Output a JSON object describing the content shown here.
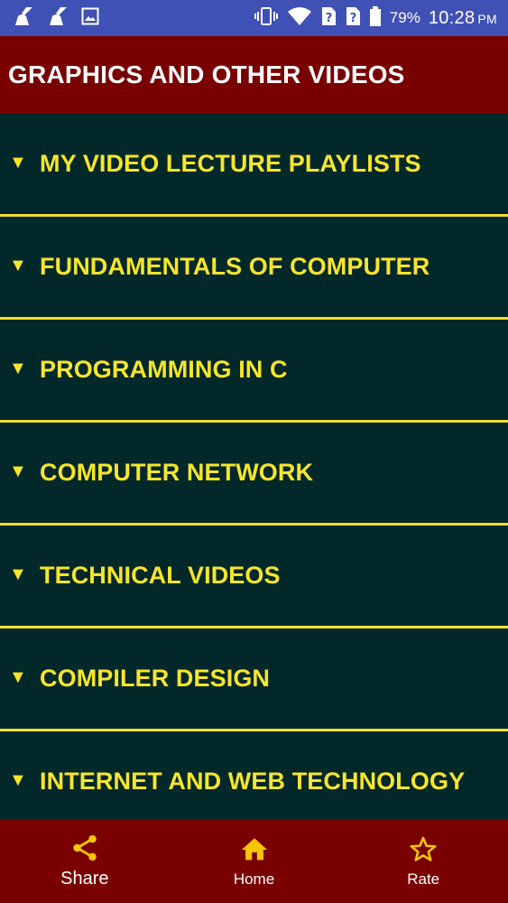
{
  "status_bar": {
    "battery_percent": "79%",
    "time": "10:28",
    "ampm": "PM",
    "icons": [
      "cleaner-icon",
      "cleaner-icon",
      "image-icon",
      "vibrate-icon",
      "wifi-icon",
      "sim-unknown-icon",
      "sim-unknown-icon",
      "battery-icon"
    ]
  },
  "app_bar": {
    "title": "GRAPHICS AND OTHER VIDEOS"
  },
  "list": {
    "arrow": "▼",
    "items": [
      {
        "label": "MY VIDEO LECTURE PLAYLISTS"
      },
      {
        "label": "FUNDAMENTALS OF COMPUTER"
      },
      {
        "label": "PROGRAMMING IN C"
      },
      {
        "label": "COMPUTER NETWORK"
      },
      {
        "label": "TECHNICAL VIDEOS"
      },
      {
        "label": "COMPILER DESIGN"
      },
      {
        "label": "INTERNET AND WEB TECHNOLOGY"
      }
    ]
  },
  "bottom_nav": {
    "share": {
      "label": "Share",
      "icon": "share-icon"
    },
    "home": {
      "label": "Home",
      "icon": "home-icon"
    },
    "rate": {
      "label": "Rate",
      "icon": "star-icon"
    }
  },
  "colors": {
    "status_bar": "#3f51b5",
    "app_bar": "#7a0000",
    "background": "#02282a",
    "accent_yellow": "#f7e52a",
    "bottom_nav": "#7a0000"
  }
}
